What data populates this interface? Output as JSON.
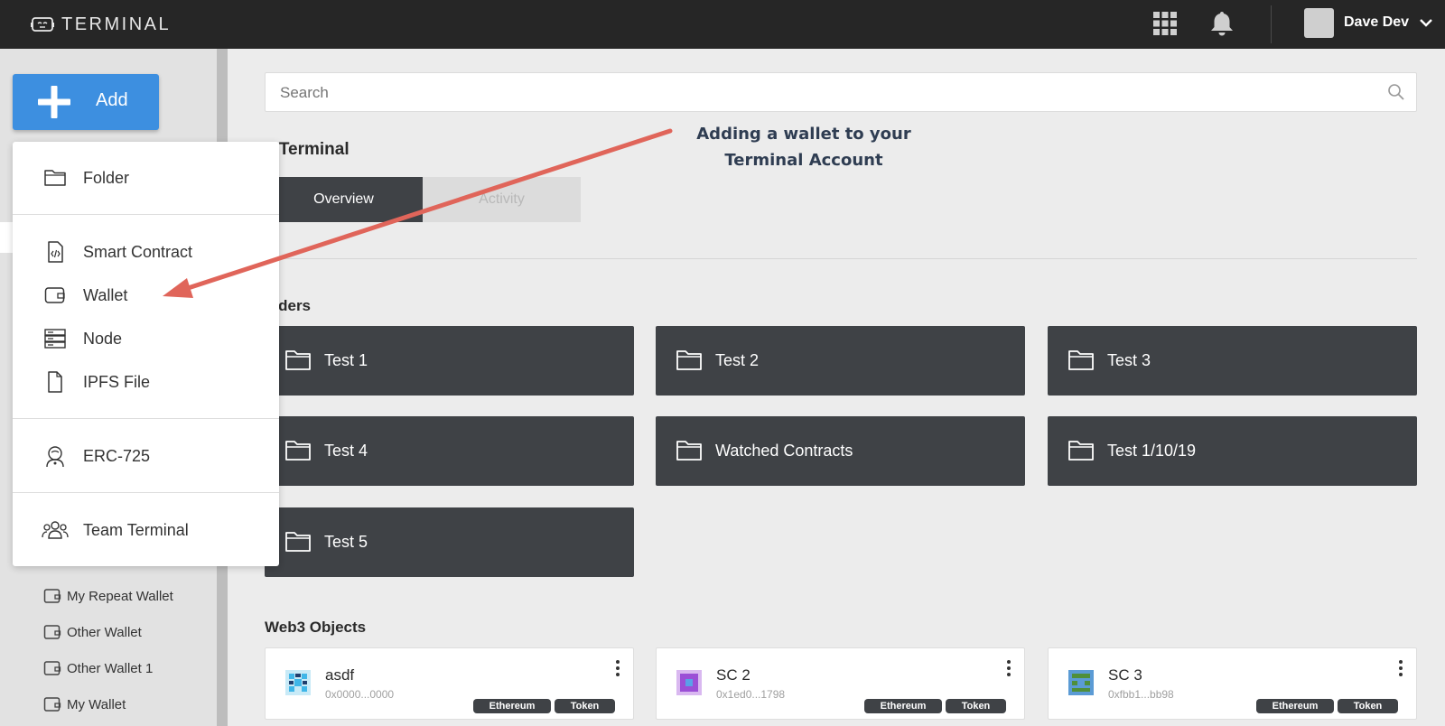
{
  "header": {
    "logo_text": "TERMINAL",
    "user_name": "Dave Dev",
    "icons": [
      "robot-logo-icon",
      "apps-grid-icon",
      "bell-icon",
      "chevron-down-icon"
    ]
  },
  "sidebar": {
    "add_label": "Add",
    "wallets": [
      {
        "label": "My Repeat Wallet"
      },
      {
        "label": "Other Wallet"
      },
      {
        "label": "Other Wallet 1"
      },
      {
        "label": "My Wallet"
      }
    ]
  },
  "add_menu": {
    "items": [
      {
        "label": "Folder",
        "icon": "folder-icon"
      },
      {
        "label": "Smart Contract",
        "icon": "smart-contract-file-icon"
      },
      {
        "label": "Wallet",
        "icon": "wallet-icon"
      },
      {
        "label": "Node",
        "icon": "server-icon"
      },
      {
        "label": "IPFS File",
        "icon": "file-icon"
      },
      {
        "label": "ERC-725",
        "icon": "identity-icon"
      },
      {
        "label": "Team Terminal",
        "icon": "team-icon"
      }
    ]
  },
  "main": {
    "search_placeholder": "Search",
    "title": "y Terminal",
    "tabs": [
      {
        "label": "Overview",
        "active": true
      },
      {
        "label": "Activity",
        "active": false
      }
    ],
    "folders_label": "olders",
    "folders": [
      {
        "label": "Test 1"
      },
      {
        "label": "Test 2"
      },
      {
        "label": "Test 3"
      },
      {
        "label": "Test 4"
      },
      {
        "label": "Watched Contracts"
      },
      {
        "label": "Test 1/10/19"
      },
      {
        "label": "Test 5"
      }
    ],
    "web3_label": "Web3 Objects",
    "web3_objects": [
      {
        "name": "asdf",
        "address": "0x0000...0000",
        "badges": [
          "Ethereum",
          "Token"
        ],
        "color": "#3fb6e8"
      },
      {
        "name": "SC 2",
        "address": "0x1ed0...1798",
        "badges": [
          "Ethereum",
          "Token"
        ],
        "color": "#9b4fd6"
      },
      {
        "name": "SC 3",
        "address": "0xfbb1...bb98",
        "badges": [
          "Ethereum",
          "Token"
        ],
        "color": "#4f8f3a"
      }
    ]
  },
  "annotation": {
    "line1": "Adding a wallet to your",
    "line2": "Terminal Account",
    "arrow_color": "#e0655a"
  }
}
